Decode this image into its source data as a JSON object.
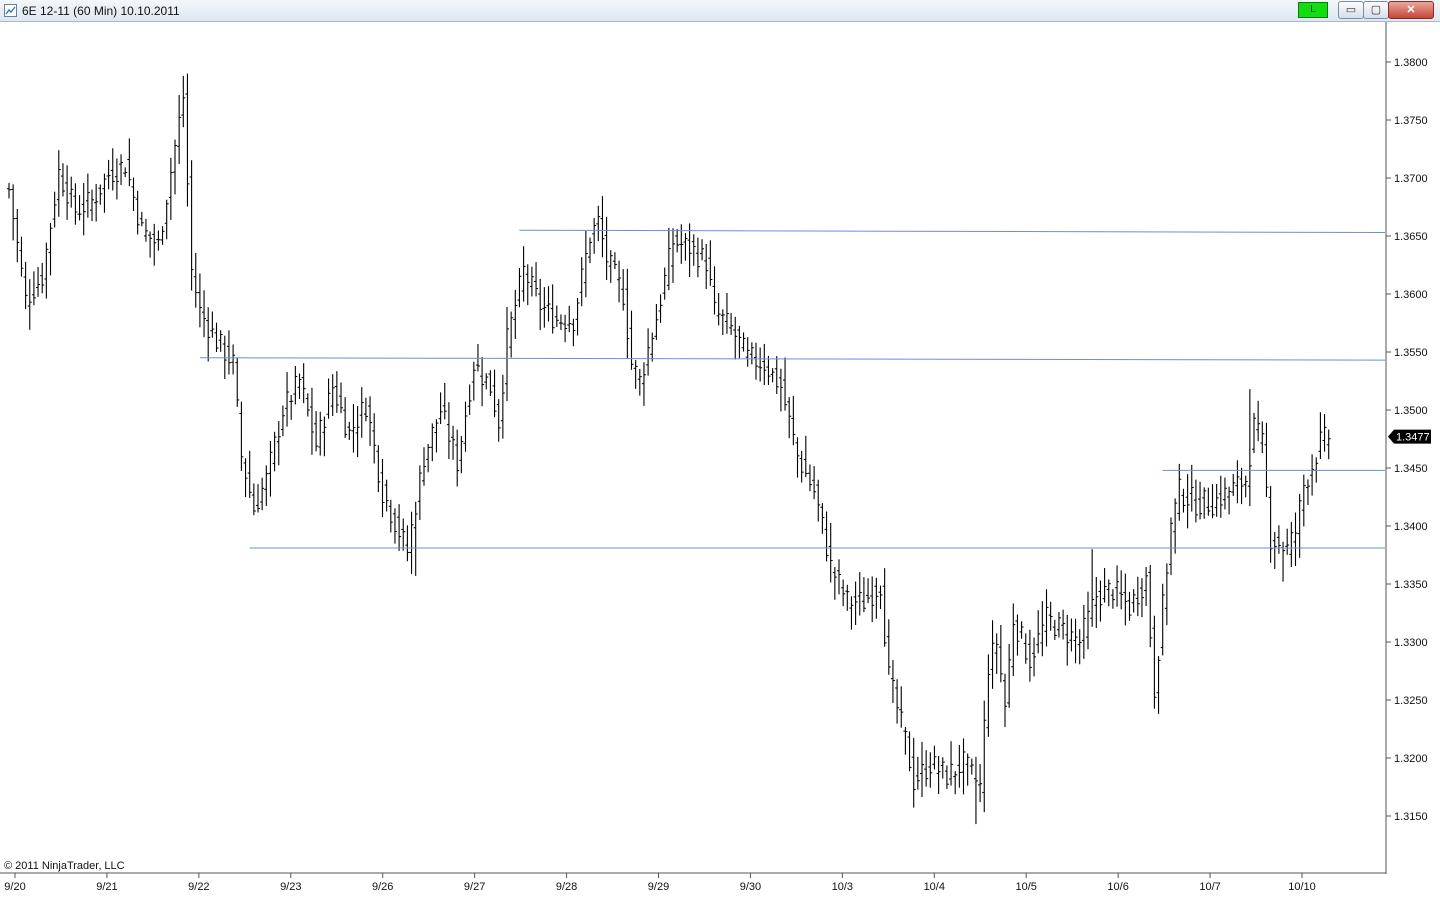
{
  "window": {
    "title": "6E 12-11 (60 Min)  10.10.2011",
    "live_label": "L",
    "live_color": "#11dd11",
    "minimize_glyph": "▭",
    "maximize_glyph": "▢",
    "close_glyph": "✕",
    "app_icon": "chart-icon"
  },
  "copyright": "© 2011 NinjaTrader, LLC",
  "chart_data": {
    "type": "ohlc",
    "title": "6E 12-11 (60 Min)",
    "ylim": [
      1.3105,
      1.3845
    ],
    "y_ticks": [
      "1.3150",
      "1.3200",
      "1.3250",
      "1.3300",
      "1.3350",
      "1.3400",
      "1.3450",
      "1.3500",
      "1.3550",
      "1.3600",
      "1.3650",
      "1.3700",
      "1.3750",
      "1.3800"
    ],
    "x_labels": [
      "9/20",
      "9/21",
      "9/22",
      "9/23",
      "9/26",
      "9/27",
      "9/28",
      "9/29",
      "9/30",
      "10/3",
      "10/4",
      "10/5",
      "10/6",
      "10/7",
      "10/10"
    ],
    "bars_per_session": 23,
    "last_price": "1.3477",
    "bar_color": "#000000",
    "level_line_color": "#6a8fd8",
    "horizontal_lines": [
      {
        "y1": 1.3655,
        "y2": 1.3653,
        "start_bar": 123
      },
      {
        "y1": 1.3545,
        "y2": 1.3543,
        "start_bar": 46
      },
      {
        "y1": 1.3448,
        "y2": 1.3448,
        "start_bar": 278
      },
      {
        "y1": 1.3381,
        "y2": 1.3381,
        "start_bar": 58
      }
    ],
    "price_path": [
      [
        0,
        1.369
      ],
      [
        4,
        1.3595
      ],
      [
        8,
        1.3615
      ],
      [
        12,
        1.3705
      ],
      [
        16,
        1.3672
      ],
      [
        20,
        1.368
      ],
      [
        24,
        1.3703
      ],
      [
        28,
        1.3712
      ],
      [
        32,
        1.3655
      ],
      [
        36,
        1.3642
      ],
      [
        42,
        1.377
      ],
      [
        44,
        1.362
      ],
      [
        46,
        1.3585
      ],
      [
        50,
        1.356
      ],
      [
        54,
        1.354
      ],
      [
        56,
        1.346
      ],
      [
        59,
        1.3415
      ],
      [
        62,
        1.344
      ],
      [
        66,
        1.35
      ],
      [
        70,
        1.3525
      ],
      [
        74,
        1.347
      ],
      [
        78,
        1.352
      ],
      [
        82,
        1.348
      ],
      [
        86,
        1.3505
      ],
      [
        90,
        1.343
      ],
      [
        94,
        1.3395
      ],
      [
        96,
        1.3378
      ],
      [
        100,
        1.346
      ],
      [
        104,
        1.35
      ],
      [
        108,
        1.3455
      ],
      [
        112,
        1.354
      ],
      [
        116,
        1.352
      ],
      [
        118,
        1.349
      ],
      [
        120,
        1.356
      ],
      [
        124,
        1.362
      ],
      [
        128,
        1.359
      ],
      [
        132,
        1.3578
      ],
      [
        136,
        1.3578
      ],
      [
        140,
        1.365
      ],
      [
        142,
        1.3662
      ],
      [
        144,
        1.363
      ],
      [
        148,
        1.36
      ],
      [
        150,
        1.354
      ],
      [
        152,
        1.3525
      ],
      [
        156,
        1.358
      ],
      [
        160,
        1.3645
      ],
      [
        164,
        1.364
      ],
      [
        168,
        1.3628
      ],
      [
        170,
        1.3585
      ],
      [
        174,
        1.357
      ],
      [
        178,
        1.3545
      ],
      [
        182,
        1.354
      ],
      [
        186,
        1.352
      ],
      [
        190,
        1.346
      ],
      [
        194,
        1.343
      ],
      [
        196,
        1.34
      ],
      [
        198,
        1.3365
      ],
      [
        202,
        1.3335
      ],
      [
        206,
        1.3335
      ],
      [
        210,
        1.335
      ],
      [
        212,
        1.327
      ],
      [
        216,
        1.3215
      ],
      [
        218,
        1.318
      ],
      [
        222,
        1.3195
      ],
      [
        226,
        1.3185
      ],
      [
        230,
        1.3195
      ],
      [
        234,
        1.3175
      ],
      [
        236,
        1.328
      ],
      [
        238,
        1.33
      ],
      [
        240,
        1.3245
      ],
      [
        242,
        1.332
      ],
      [
        246,
        1.3285
      ],
      [
        250,
        1.332
      ],
      [
        254,
        1.331
      ],
      [
        258,
        1.33
      ],
      [
        262,
        1.334
      ],
      [
        266,
        1.3345
      ],
      [
        270,
        1.333
      ],
      [
        274,
        1.3355
      ],
      [
        276,
        1.326
      ],
      [
        280,
        1.34
      ],
      [
        282,
        1.343
      ],
      [
        286,
        1.342
      ],
      [
        290,
        1.342
      ],
      [
        294,
        1.343
      ],
      [
        298,
        1.344
      ],
      [
        300,
        1.3485
      ],
      [
        302,
        1.347
      ],
      [
        304,
        1.339
      ],
      [
        306,
        1.3385
      ],
      [
        308,
        1.338
      ],
      [
        310,
        1.3395
      ],
      [
        312,
        1.3435
      ],
      [
        314,
        1.3452
      ],
      [
        316,
        1.3472
      ],
      [
        318,
        1.3477
      ]
    ]
  }
}
